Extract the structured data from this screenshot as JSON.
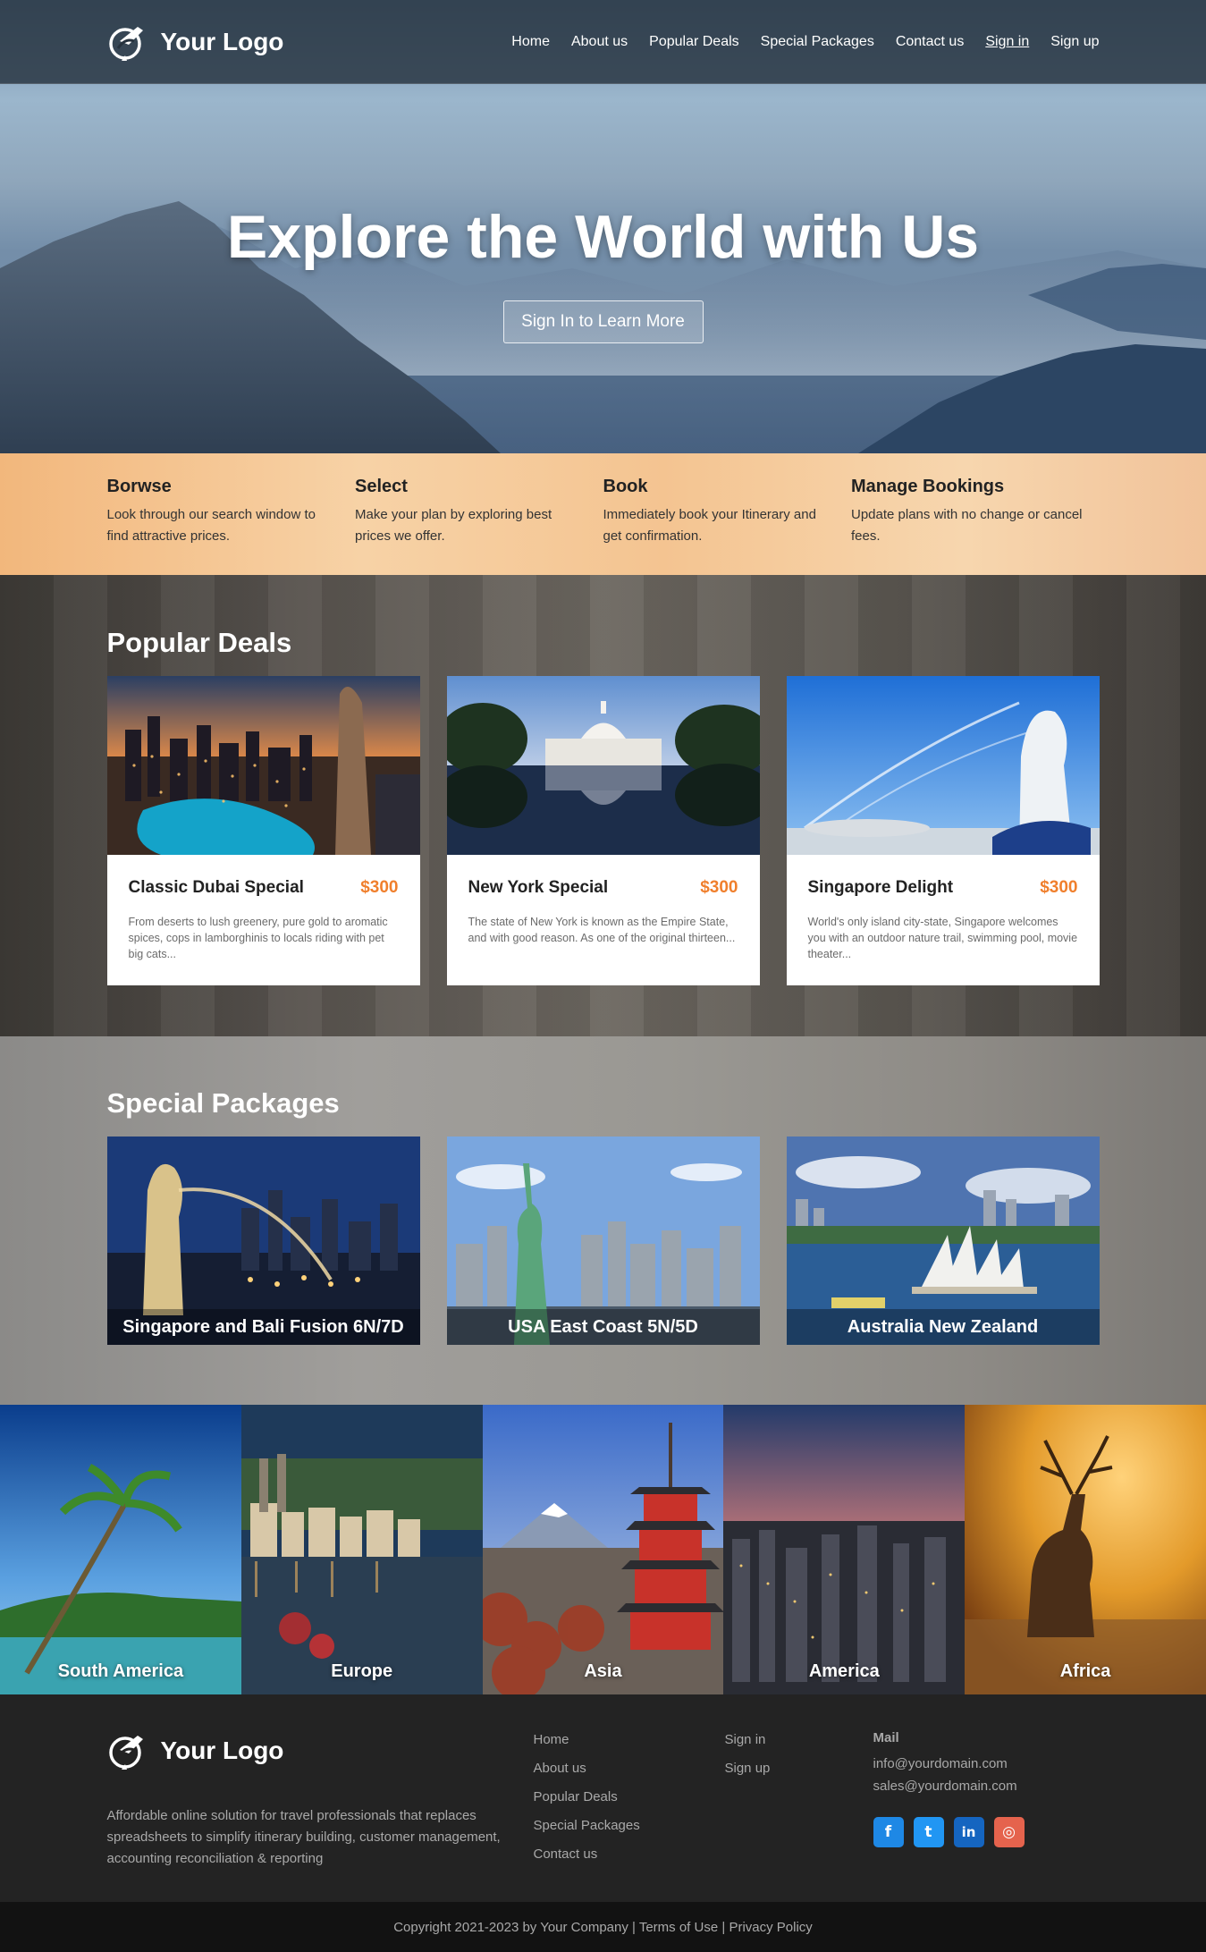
{
  "brand": {
    "name": "Your Logo"
  },
  "nav": {
    "items": [
      "Home",
      "About us",
      "Popular Deals",
      "Special Packages",
      "Contact us"
    ],
    "sign_in": "Sign in",
    "sign_up": "Sign up"
  },
  "hero": {
    "title": "Explore the World with Us",
    "button": "Sign In to Learn More"
  },
  "steps": [
    {
      "title": "Borwse",
      "text": "Look through our search window to find attractive prices."
    },
    {
      "title": "Select",
      "text": "Make your plan by exploring best prices we offer."
    },
    {
      "title": "Book",
      "text": "Immediately book your Itinerary and get confirmation."
    },
    {
      "title": "Manage Bookings",
      "text": "Update plans with no change or cancel fees."
    }
  ],
  "popular_deals": {
    "title": "Popular Deals",
    "cards": [
      {
        "title": "Classic Dubai Special",
        "price": "$300",
        "desc": "From deserts to lush greenery, pure gold to aromatic spices, cops in lamborghinis to locals riding with pet big cats..."
      },
      {
        "title": "New York Special",
        "price": "$300",
        "desc": "The state of New York is known as the Empire State, and with good reason. As one of the original thirteen..."
      },
      {
        "title": "Singapore Delight",
        "price": "$300",
        "desc": "World's only island city-state, Singapore welcomes you with an outdoor nature trail, swimming pool, movie theater..."
      }
    ]
  },
  "special_packages": {
    "title": "Special Packages",
    "items": [
      "Singapore and Bali Fusion 6N/7D",
      "USA East Coast 5N/5D",
      "Australia New Zealand"
    ]
  },
  "regions": [
    "South America",
    "Europe",
    "Asia",
    "America",
    "Africa"
  ],
  "footer": {
    "about": "Affordable online solution for travel professionals that replaces spreadsheets to simplify itinerary building, customer management, accounting reconciliation & reporting",
    "links_col1": [
      "Home",
      "About us",
      "Popular Deals",
      "Special Packages",
      "Contact us"
    ],
    "links_col2": [
      "Sign in",
      "Sign up"
    ],
    "mail_heading": "Mail",
    "emails": [
      "info@yourdomain.com",
      "sales@yourdomain.com"
    ],
    "social": [
      {
        "icon": "facebook-icon",
        "glyph": "f",
        "color": "#1e88e5"
      },
      {
        "icon": "twitter-icon",
        "glyph": "t",
        "color": "#2196f3"
      },
      {
        "icon": "linkedin-icon",
        "glyph": "in",
        "color": "#1565c0"
      },
      {
        "icon": "instagram-icon",
        "glyph": "◎",
        "color": "#e5634d"
      }
    ],
    "copyright": "Copyright 2021-2023 by Your Company",
    "sep1": " | ",
    "terms": "Terms of Use",
    "sep2": " | ",
    "privacy": "Privacy Policy"
  }
}
